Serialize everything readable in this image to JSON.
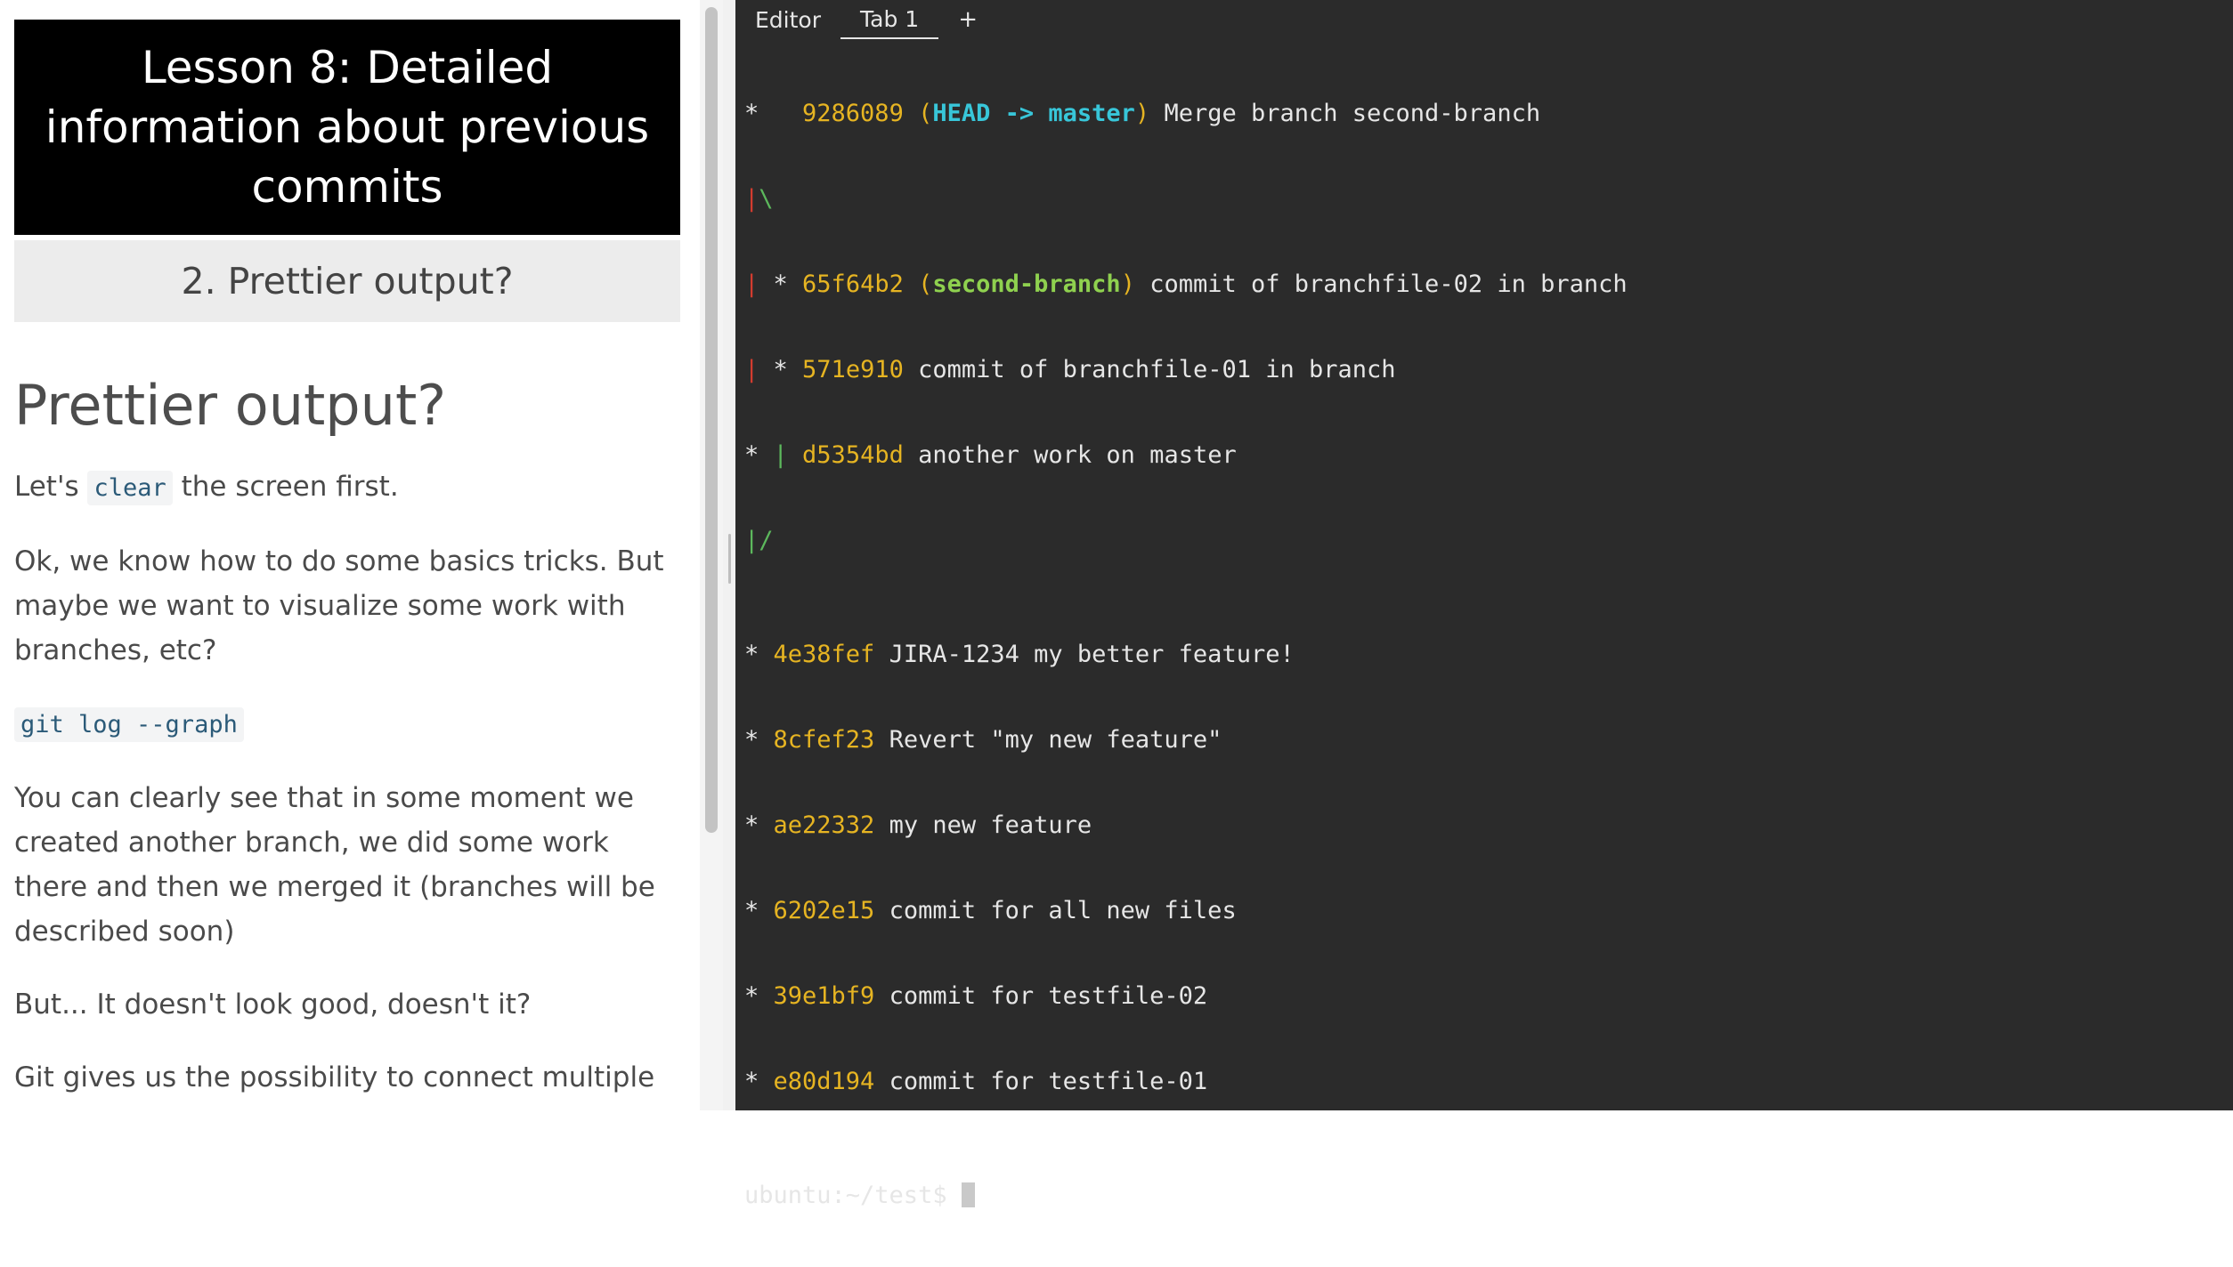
{
  "lesson": {
    "title": "Lesson 8: Detailed information about previous commits",
    "step_title": "2. Prettier output?",
    "heading": "Prettier output?",
    "p1_before": "Let's ",
    "p1_code": "clear",
    "p1_after": " the screen first.",
    "p2": "Ok, we know how to do some basics tricks. But maybe we want to visualize some work with branches, etc?",
    "code_block": "git log --graph",
    "p3": "You can clearly see that in some moment we created another branch, we did some work there and then we merged it (branches will be described soon)",
    "p4": "But... It doesn't look good, doesn't it?",
    "p5": "Git gives us the possibility to connect multiple"
  },
  "tabs": {
    "editor": "Editor",
    "tab1": "Tab 1",
    "add": "+"
  },
  "terminal": {
    "l1": {
      "graph": "*   ",
      "hash": "9286089",
      "open": " (",
      "head": "HEAD -> master",
      "close": ")",
      "msg": " Merge branch second-branch"
    },
    "l2": {
      "g1": "|",
      "g2": "\\"
    },
    "l3": {
      "g1": "|",
      "g2": " * ",
      "hash": "65f64b2",
      "open": " (",
      "branch": "second-branch",
      "close": ")",
      "msg": " commit of branchfile-02 in branch"
    },
    "l4": {
      "g1": "|",
      "g2": " * ",
      "hash": "571e910",
      "msg": " commit of branchfile-01 in branch"
    },
    "l5": {
      "g1": "* ",
      "g2": "|",
      "sp": " ",
      "hash": "d5354bd",
      "msg": " another work on master"
    },
    "l6": {
      "g1": "|/"
    },
    "commits": [
      {
        "graph": "* ",
        "hash": "4e38fef",
        "msg": " JIRA-1234 my better feature!"
      },
      {
        "graph": "* ",
        "hash": "8cfef23",
        "msg": " Revert \"my new feature\""
      },
      {
        "graph": "* ",
        "hash": "ae22332",
        "msg": " my new feature"
      },
      {
        "graph": "* ",
        "hash": "6202e15",
        "msg": " commit for all new files"
      },
      {
        "graph": "* ",
        "hash": "39e1bf9",
        "msg": " commit for testfile-02"
      },
      {
        "graph": "* ",
        "hash": "e80d194",
        "msg": " commit for testfile-01"
      }
    ],
    "prompt": "ubuntu:~/test$ "
  },
  "colors": {
    "terminal_bg": "#2b2b2b",
    "hash": "#e6b422",
    "head": "#38c6d9",
    "branch": "#8fd14f",
    "graph_red": "#d23c2f",
    "graph_green": "#5cb85c"
  }
}
